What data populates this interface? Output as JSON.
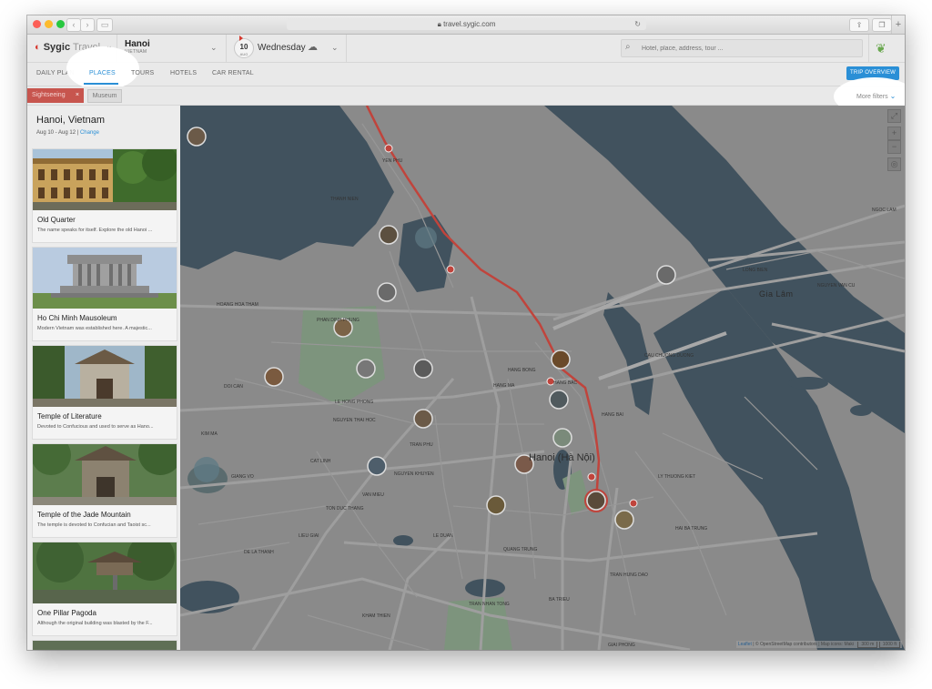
{
  "browser": {
    "url": "travel.sygic.com"
  },
  "header": {
    "logo_brand": "Sygic",
    "logo_suffix": "Travel",
    "city_name": "Hanoi",
    "city_country": "VIETNAM",
    "date_day": "10",
    "date_month": "AUG",
    "weekday": "Wednesday",
    "search_placeholder": "Hotel, place, address, tour ..."
  },
  "tabs": [
    {
      "label": "DAILY PLAN",
      "active": false
    },
    {
      "label": "PLACES",
      "active": true
    },
    {
      "label": "TOURS",
      "active": false
    },
    {
      "label": "HOTELS",
      "active": false
    },
    {
      "label": "CAR RENTAL",
      "active": false
    }
  ],
  "trip_overview_label": "TRIP OVERVIEW",
  "filters": {
    "active_chip": "Sightseeing",
    "chip_remove": "×",
    "other_chip": "Museum",
    "more_filters": "More filters"
  },
  "sidebar": {
    "title": "Hanoi, Vietnam",
    "dates": "Aug 10 - Aug 12 |",
    "change_link": "Change",
    "places": [
      {
        "title": "Old Quarter",
        "desc": "The name speaks for itself. Explore the old Hanoi ..."
      },
      {
        "title": "Ho Chi Minh Mausoleum",
        "desc": "Modern Vietnam was established here. A majestic..."
      },
      {
        "title": "Temple of Literature",
        "desc": "Devoted to Confucious and used to serve as Hano..."
      },
      {
        "title": "Temple of the Jade Mountain",
        "desc": "The temple is devoted to Confucian and Taoist sc..."
      },
      {
        "title": "One Pillar Pagoda",
        "desc": "Although the original building was blasted by the F..."
      }
    ]
  },
  "map": {
    "city_label": "Hanoi (Hà Nội)",
    "district_label": "Gia Lâm",
    "zoom_in": "+",
    "zoom_out": "−",
    "attribution_leaflet": "Leaflet",
    "attribution_rest": "| © OpenStreetMap contributors | Map icons: Maki",
    "scale_m": "300 m",
    "scale_ft": "1000 ft",
    "street_labels": [
      "PHAN DINH PHUNG",
      "HOANG HOA THAM",
      "DOI CAN",
      "KIM MA",
      "LE HONG PHONG",
      "NGUYEN THAI HOC",
      "TRAN PHU",
      "HANG BAI",
      "TRAN HUNG DAO",
      "KHAM THIEN",
      "TON DUC THANG",
      "GIAI PHONG",
      "NGOC LAM",
      "NGUYEN VAN CU",
      "LONG BIEN",
      "CAU CHUONG DUONG",
      "TRAN NHAN TONG",
      "LE DUAN",
      "QUANG TRUNG",
      "BA TRIEU",
      "HANG BONG",
      "YEN PHU",
      "THANH NIEN",
      "LIEU GIAI",
      "GIANG VO",
      "CAT LINH",
      "LY THUONG KIET",
      "HAI BA TRUNG",
      "HANG BAC",
      "NGUYEN KHUYEN",
      "VAN MIEU",
      "HANG MA",
      "DE LA THANH"
    ]
  },
  "colors": {
    "accent_blue": "#2a8fd6",
    "chip_red": "#c7554e",
    "route_red": "#c0443c",
    "water": "#41525e",
    "land": "#8a8a8a",
    "park": "#7d947d"
  }
}
